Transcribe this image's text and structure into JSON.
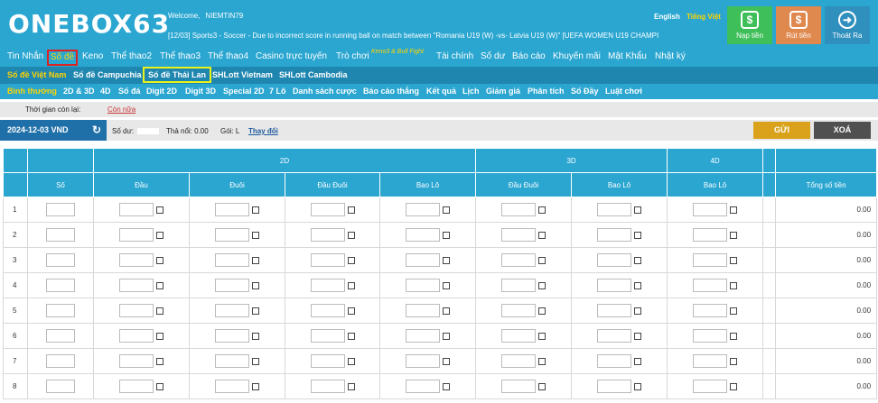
{
  "header": {
    "logo": "ONEBOX63",
    "welcome_label": "Welcome,",
    "username": "NIEMTIN79",
    "ticker": "[12/03] Sports3 - Soccer - Due to incorrect score in running ball on match between \"Romania U19 (W) -vs- Latvia U19 (W)\" [UEFA WOMEN U19 CHAMPI",
    "lang_en": "English",
    "lang_vi": "Tiếng Việt",
    "buttons": {
      "deposit": "Nạp tiền",
      "withdraw": "Rút tiền",
      "logout": "Thoát Ra"
    },
    "deposit_icon_glyph": "$",
    "withdraw_icon_glyph": "$",
    "logout_icon_glyph": "➜"
  },
  "nav1": {
    "items": [
      "Tin Nhắn",
      "Số đề",
      "Keno",
      "Thể thao2",
      "Thể thao3",
      "Thể thao4",
      "Casino trực tuyến",
      "Trò chơi",
      "Tài chính",
      "Số dư",
      "Báo cáo",
      "Khuyến mãi",
      "Mật Khẩu",
      "Nhật ký"
    ],
    "promo": "Keno3 & Bull Fight",
    "active_index": 1
  },
  "nav2": {
    "items": [
      "Số đề Việt Nam",
      "Số đề Campuchia",
      "Số đề Thái Lan",
      "SHLott Vietnam",
      "SHLott Cambodia"
    ]
  },
  "nav3": {
    "items": [
      "Bình thường",
      "2D & 3D",
      "4D",
      "Số đá",
      "Digit 2D",
      "Digit 3D",
      "Special 2D",
      "7 Lô",
      "Danh sách cược",
      "Báo cáo thắng",
      "Kết quả",
      "Lịch",
      "Giảm giá",
      "Phân tích",
      "Số Đầy",
      "Luật chơi"
    ]
  },
  "time_row": {
    "label": "Thời gian còn lại:",
    "value": "Còn nữa"
  },
  "info_row": {
    "date": "2024-12-03 VND",
    "balance_label": "Số dư: ",
    "outstanding": "Thả nổi: 0.00",
    "package_label": "Gói: L",
    "change_link": "Thay đổi",
    "send_button": "GỬI",
    "clear_button": "XOÁ"
  },
  "table": {
    "groups": [
      "2D",
      "3D",
      "4D",
      "Tổng số tiền"
    ],
    "columns": [
      "Số",
      "Đầu",
      "Đuôi",
      "Đầu Đuôi",
      "Bao Lô",
      "Đầu Đuôi",
      "Bao Lô",
      "Bao Lô",
      "Tổng số tiền"
    ],
    "rows": [
      {
        "n": "1",
        "total": "0.00"
      },
      {
        "n": "2",
        "total": "0.00"
      },
      {
        "n": "3",
        "total": "0.00"
      },
      {
        "n": "4",
        "total": "0.00"
      },
      {
        "n": "5",
        "total": "0.00"
      },
      {
        "n": "6",
        "total": "0.00"
      },
      {
        "n": "7",
        "total": "0.00"
      },
      {
        "n": "8",
        "total": "0.00"
      }
    ]
  }
}
